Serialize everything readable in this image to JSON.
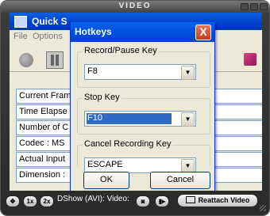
{
  "player": {
    "title": "VIDEO",
    "bottom_bar": {
      "move_label": "✥",
      "zoom_1x": "1x",
      "zoom_2x": "2x",
      "status": "DShow (AVI): Video:",
      "reattach": "Reattach Video"
    }
  },
  "app": {
    "title": "Quick S",
    "menu": [
      "File",
      "Options"
    ],
    "rows": [
      "Current Fram",
      "Time Elapse",
      "Number of C",
      "Codec : MS",
      "Actual Input",
      "Dimension :"
    ]
  },
  "dialog": {
    "title": "Hotkeys",
    "close": "X",
    "groups": [
      {
        "label": "Record/Pause Key",
        "value": "F8"
      },
      {
        "label": "Stop Key",
        "value": "F10"
      },
      {
        "label": "Cancel Recording Key",
        "value": "ESCAPE"
      }
    ],
    "ok_label": "OK",
    "cancel_label": "Cancel"
  },
  "colors": {
    "xp_title_blue": "#0050de",
    "selection_blue": "#316ac5",
    "close_red": "#c8381a"
  }
}
